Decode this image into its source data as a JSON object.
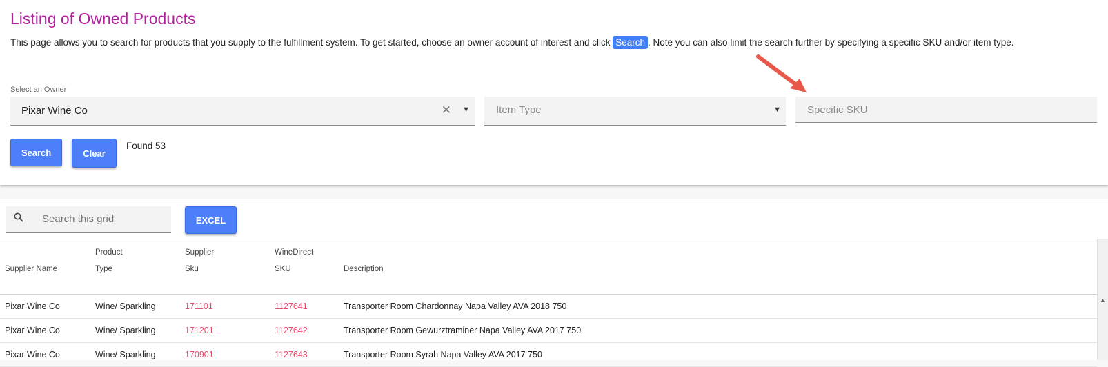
{
  "header": {
    "title": "Listing of Owned Products",
    "intro_before": "This page allows you to search for products that you supply to the fulfillment system. To get started, choose an owner account of interest and click ",
    "intro_chip": "Search",
    "intro_after": ". Note you can also limit the search further by specifying a specific SKU and/or item type."
  },
  "filters": {
    "owner_label": "Select an Owner",
    "owner_value": "Pixar Wine Co",
    "item_type_placeholder": "Item Type",
    "sku_placeholder": "Specific SKU"
  },
  "actions": {
    "search_label": "Search",
    "clear_label": "Clear",
    "found_text": "Found 53"
  },
  "grid": {
    "search_placeholder": "Search this grid",
    "excel_label": "EXCEL",
    "columns": [
      {
        "line1": "",
        "line2": "Supplier Name"
      },
      {
        "line1": "Product",
        "line2": "Type"
      },
      {
        "line1": "Supplier",
        "line2": "Sku"
      },
      {
        "line1": "WineDirect",
        "line2": "SKU"
      },
      {
        "line1": "",
        "line2": "Description"
      }
    ],
    "rows": [
      {
        "supplier": "Pixar Wine Co",
        "type": "Wine/ Sparkling",
        "sku": "171101",
        "wd_sku": "1127641",
        "description": "Transporter Room Chardonnay Napa Valley AVA 2018 750"
      },
      {
        "supplier": "Pixar Wine Co",
        "type": "Wine/ Sparkling",
        "sku": "171201",
        "wd_sku": "1127642",
        "description": "Transporter Room Gewurztraminer Napa Valley AVA 2017 750"
      },
      {
        "supplier": "Pixar Wine Co",
        "type": "Wine/ Sparkling",
        "sku": "170901",
        "wd_sku": "1127643",
        "description": "Transporter Room Syrah Napa Valley AVA 2017 750"
      }
    ]
  },
  "colors": {
    "title": "#b0219c",
    "button": "#4e7ffa",
    "link": "#e64a6e",
    "arrow": "#e8584a"
  },
  "icons": {
    "clear": "close-icon",
    "dropdown": "chevron-down-icon",
    "grid_search": "search-icon",
    "annotation": "arrow-icon"
  }
}
